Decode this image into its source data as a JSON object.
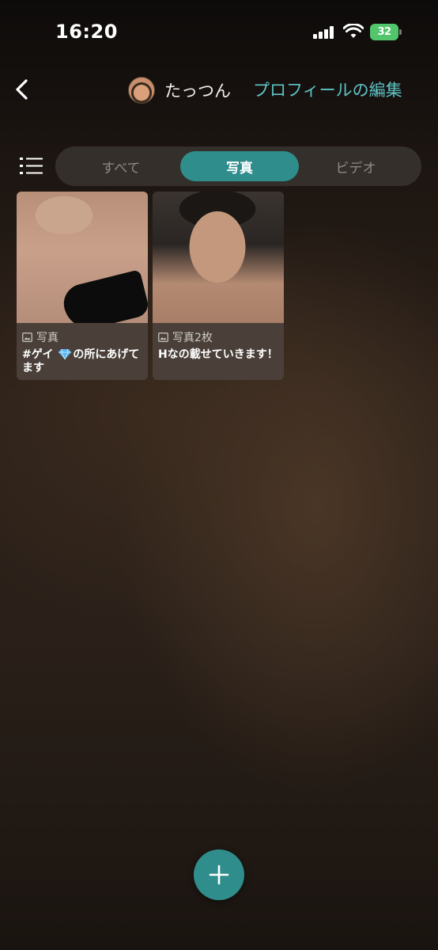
{
  "status_bar": {
    "time": "16:20",
    "battery": "32",
    "battery_color": "#53c56d"
  },
  "nav": {
    "back_icon": "chevron-left-icon",
    "username": "たっつん",
    "edit_profile": "プロフィールの編集"
  },
  "filter": {
    "list_icon": "list-icon",
    "tabs": [
      {
        "label": "すべて",
        "active": false
      },
      {
        "label": "写真",
        "active": true
      },
      {
        "label": "ビデオ",
        "active": false
      }
    ]
  },
  "posts": [
    {
      "type_label": "写真",
      "caption_pre": "#ゲイ ",
      "caption_emoji": "gem-icon",
      "caption_post": "の所にあげてます"
    },
    {
      "type_label": "写真2枚",
      "caption": "Hなの載せていきます！"
    }
  ],
  "fab": {
    "icon": "plus-icon"
  },
  "colors": {
    "accent": "#2f8d8c",
    "link": "#5fc4c6"
  }
}
